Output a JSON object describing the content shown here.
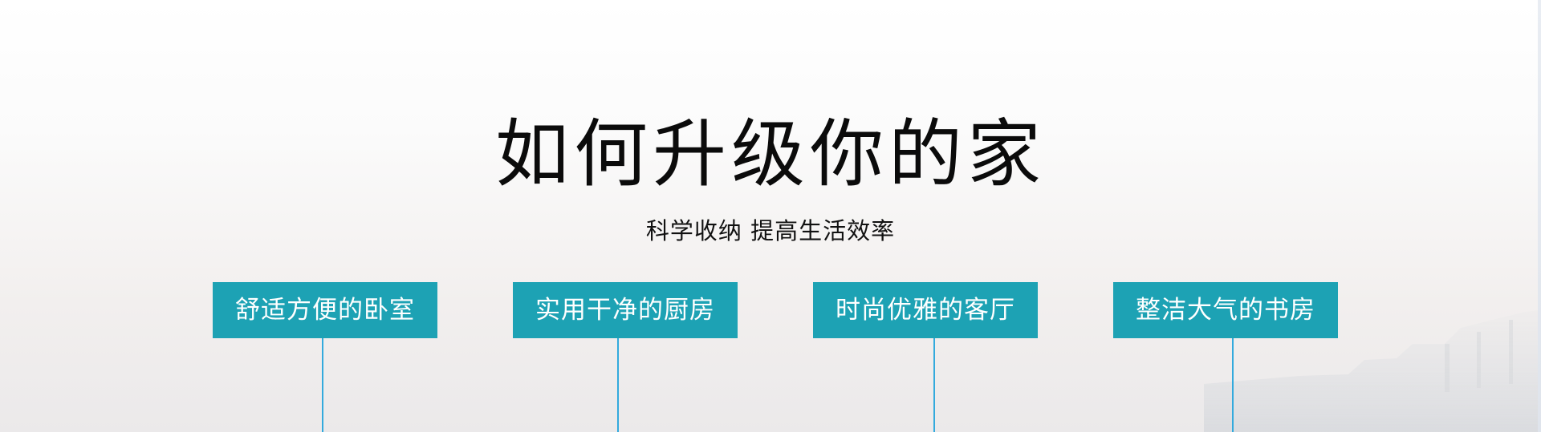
{
  "hero": {
    "title": "如何升级你的家",
    "subtitle": "科学收纳  提高生活效率",
    "accent_color": "#1da2b4",
    "line_color": "#33aadd",
    "rooms": [
      {
        "label": "舒适方便的卧室"
      },
      {
        "label": "实用干净的厨房"
      },
      {
        "label": "时尚优雅的客厅"
      },
      {
        "label": "整洁大气的书房"
      }
    ]
  }
}
